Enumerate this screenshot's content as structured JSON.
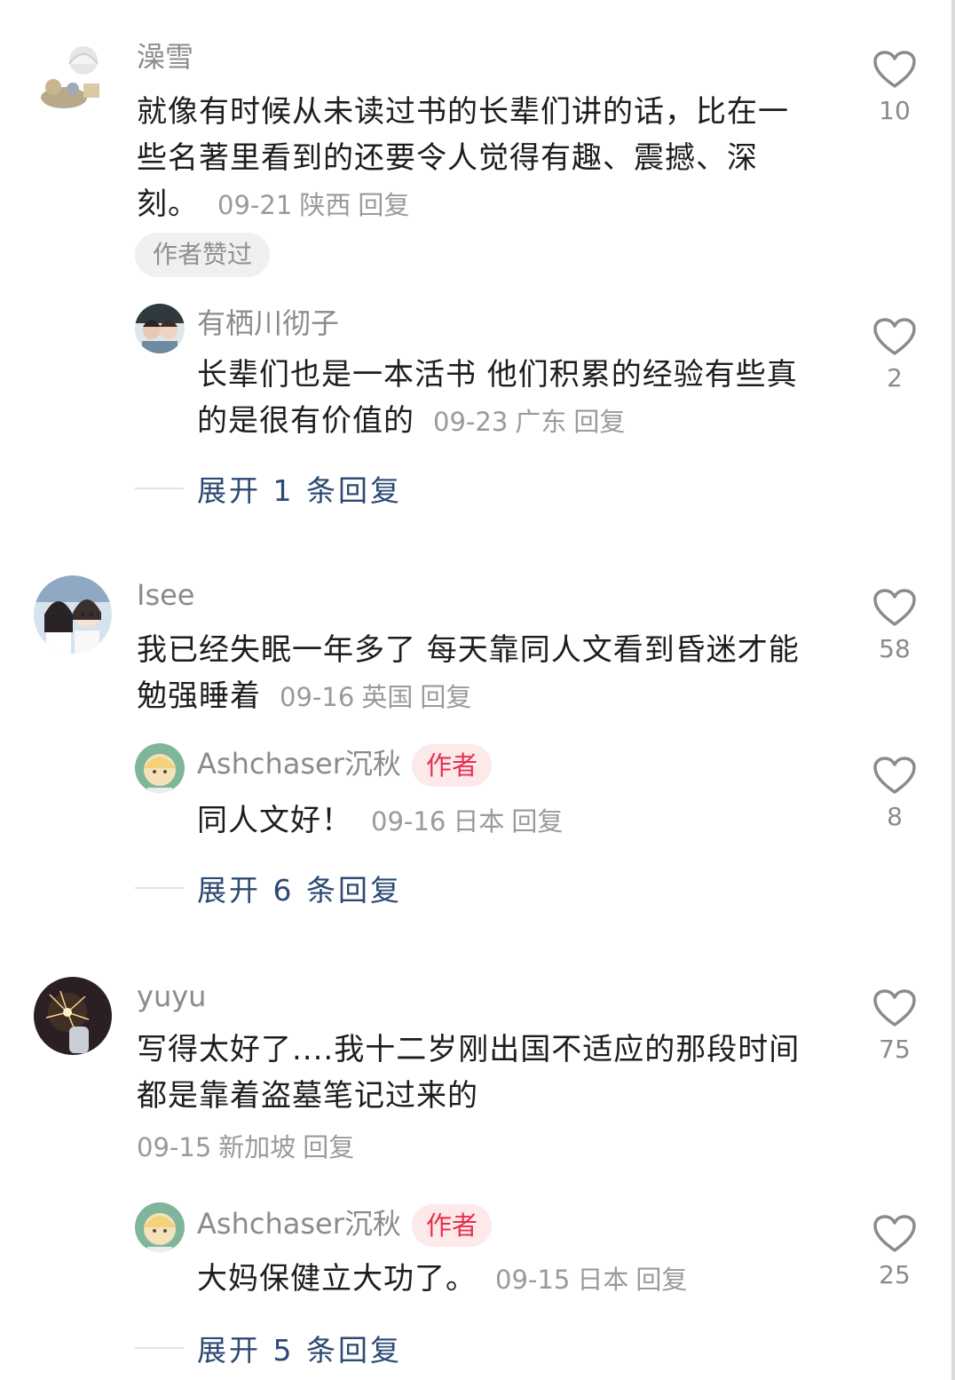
{
  "comments": [
    {
      "username": "澡雪",
      "text": "就像有时候从未读过书的长辈们讲的话，比在一些名著里看到的还要令人觉得有趣、震撼、深刻。",
      "date": "09-21",
      "location": "陕西",
      "reply_label": "回复",
      "likes": "10",
      "author_liked_label": "作者赞过",
      "reply": {
        "username": "有栖川彻子",
        "text": "长辈们也是一本活书 他们积累的经验有些真的是很有价值的",
        "date": "09-23",
        "location": "广东",
        "reply_label": "回复",
        "likes": "2"
      },
      "expand_label": "展开 1 条回复"
    },
    {
      "username": "Isee",
      "text": "我已经失眠一年多了 每天靠同人文看到昏迷才能勉强睡着",
      "date": "09-16",
      "location": "英国",
      "reply_label": "回复",
      "likes": "58",
      "reply": {
        "username": "Ashchaser沉秋",
        "badge": "作者",
        "text": "同人文好！",
        "date": "09-16",
        "location": "日本",
        "reply_label": "回复",
        "likes": "8"
      },
      "expand_label": "展开 6 条回复"
    },
    {
      "username": "yuyu",
      "text": "写得太好了....我十二岁刚出国不适应的那段时间都是靠着盗墓笔记过来的",
      "date": "09-15",
      "location": "新加坡",
      "reply_label": "回复",
      "likes": "75",
      "reply": {
        "username": "Ashchaser沉秋",
        "badge": "作者",
        "text": "大妈保健立大功了。",
        "date": "09-15",
        "location": "日本",
        "reply_label": "回复",
        "likes": "25"
      },
      "expand_label": "展开 5 条回复"
    }
  ],
  "icons": {
    "like": "heart-outline-icon"
  },
  "colors": {
    "link": "#2c4a73",
    "author_badge": "#e8304d",
    "meta": "#9a9a9a"
  }
}
